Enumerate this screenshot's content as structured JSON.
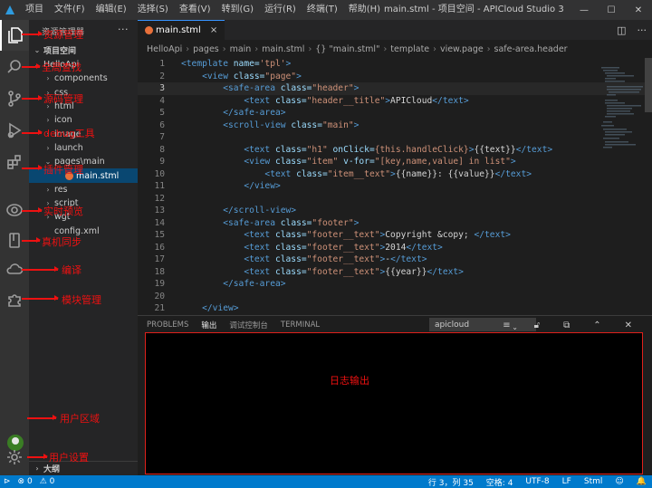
{
  "titlebar": {
    "menus": [
      "项目",
      "文件(F)",
      "编辑(E)",
      "选择(S)",
      "查看(V)",
      "转到(G)",
      "运行(R)",
      "终端(T)",
      "帮助(H)"
    ],
    "title": "main.stml - 项目空间 - APICloud Studio 3",
    "controls": [
      "—",
      "☐",
      "✕"
    ]
  },
  "activity_bar": [
    "files-icon",
    "search-icon",
    "source-control-icon",
    "debug-icon",
    "extensions-icon",
    "preview-icon",
    "sync-icon",
    "cloud-icon",
    "puzzle-icon",
    "avatar",
    "gear-icon"
  ],
  "sidebar": {
    "header": "资源管理器",
    "more": "···",
    "workspace": "项目空间",
    "tree": [
      {
        "label": "HelloApi",
        "twisty": "⌄",
        "level": 1
      },
      {
        "label": "components",
        "twisty": "›",
        "level": 2
      },
      {
        "label": "css",
        "twisty": "›",
        "level": 2
      },
      {
        "label": "html",
        "twisty": "›",
        "level": 2
      },
      {
        "label": "icon",
        "twisty": "›",
        "level": 2
      },
      {
        "label": "image",
        "twisty": "›",
        "level": 2
      },
      {
        "label": "launch",
        "twisty": "›",
        "level": 2
      },
      {
        "label": "pages\\main",
        "twisty": "⌄",
        "level": 2
      },
      {
        "label": "main.stml",
        "twisty": "",
        "level": 3,
        "selected": true
      },
      {
        "label": "res",
        "twisty": "›",
        "level": 2
      },
      {
        "label": "script",
        "twisty": "›",
        "level": 2
      },
      {
        "label": "wgt",
        "twisty": "›",
        "level": 2
      },
      {
        "label": "config.xml",
        "twisty": "",
        "level": 2
      }
    ],
    "outline": "大纲"
  },
  "editor": {
    "tab": "main.stml",
    "tab_close": "×",
    "breadcrumbs": [
      "HelloApi",
      "pages",
      "main",
      "main.stml",
      "{} \"main.stml\"",
      "template",
      "view.page",
      "safe-area.header"
    ],
    "lines": [
      [
        [
          "t",
          "<template "
        ],
        [
          "a",
          "name="
        ],
        [
          "s",
          "'tpl'"
        ],
        [
          "t",
          ">"
        ]
      ],
      [
        [
          "x",
          "    "
        ],
        [
          "t",
          "<view "
        ],
        [
          "a",
          "class="
        ],
        [
          "s",
          "\"page\""
        ],
        [
          "t",
          ">"
        ]
      ],
      [
        [
          "x",
          "        "
        ],
        [
          "t",
          "<safe-area "
        ],
        [
          "a",
          "class="
        ],
        [
          "s",
          "\"header\""
        ],
        [
          "t",
          ">"
        ]
      ],
      [
        [
          "x",
          "            "
        ],
        [
          "t",
          "<text "
        ],
        [
          "a",
          "class="
        ],
        [
          "s",
          "\"header__title\""
        ],
        [
          "t",
          ">"
        ],
        [
          "x",
          "APICloud"
        ],
        [
          "t",
          "</text>"
        ]
      ],
      [
        [
          "x",
          "        "
        ],
        [
          "t",
          "</safe-area>"
        ]
      ],
      [
        [
          "x",
          "        "
        ],
        [
          "t",
          "<scroll-view "
        ],
        [
          "a",
          "class="
        ],
        [
          "s",
          "\"main\""
        ],
        [
          "t",
          ">"
        ]
      ],
      [],
      [
        [
          "x",
          "            "
        ],
        [
          "t",
          "<text "
        ],
        [
          "a",
          "class="
        ],
        [
          "s",
          "\"h1\" "
        ],
        [
          "a",
          "onClick="
        ],
        [
          "s",
          "{this.handleClick}"
        ],
        [
          "t",
          ">"
        ],
        [
          "x",
          "{{text}}"
        ],
        [
          "t",
          "</text>"
        ]
      ],
      [
        [
          "x",
          "            "
        ],
        [
          "t",
          "<view "
        ],
        [
          "a",
          "class="
        ],
        [
          "s",
          "\"item\" "
        ],
        [
          "a",
          "v-for="
        ],
        [
          "s",
          "\"[key,name,value] in list\""
        ],
        [
          "t",
          ">"
        ]
      ],
      [
        [
          "x",
          "                "
        ],
        [
          "t",
          "<text "
        ],
        [
          "a",
          "class="
        ],
        [
          "s",
          "\"item__text\""
        ],
        [
          "t",
          ">"
        ],
        [
          "x",
          "{{name}}: {{value}}"
        ],
        [
          "t",
          "</text>"
        ]
      ],
      [
        [
          "x",
          "            "
        ],
        [
          "t",
          "</view>"
        ]
      ],
      [],
      [
        [
          "x",
          "        "
        ],
        [
          "t",
          "</scroll-view>"
        ]
      ],
      [
        [
          "x",
          "        "
        ],
        [
          "t",
          "<safe-area "
        ],
        [
          "a",
          "class="
        ],
        [
          "s",
          "\"footer\""
        ],
        [
          "t",
          ">"
        ]
      ],
      [
        [
          "x",
          "            "
        ],
        [
          "t",
          "<text "
        ],
        [
          "a",
          "class="
        ],
        [
          "s",
          "\"footer__text\""
        ],
        [
          "t",
          ">"
        ],
        [
          "x",
          "Copyright &copy; "
        ],
        [
          "t",
          "</text>"
        ]
      ],
      [
        [
          "x",
          "            "
        ],
        [
          "t",
          "<text "
        ],
        [
          "a",
          "class="
        ],
        [
          "s",
          "\"footer__text\""
        ],
        [
          "t",
          ">"
        ],
        [
          "x",
          "2014"
        ],
        [
          "t",
          "</text>"
        ]
      ],
      [
        [
          "x",
          "            "
        ],
        [
          "t",
          "<text "
        ],
        [
          "a",
          "class="
        ],
        [
          "s",
          "\"footer__text\""
        ],
        [
          "t",
          ">"
        ],
        [
          "x",
          "-"
        ],
        [
          "t",
          "</text>"
        ]
      ],
      [
        [
          "x",
          "            "
        ],
        [
          "t",
          "<text "
        ],
        [
          "a",
          "class="
        ],
        [
          "s",
          "\"footer__text\""
        ],
        [
          "t",
          ">"
        ],
        [
          "x",
          "{{year}}"
        ],
        [
          "t",
          "</text>"
        ]
      ],
      [
        [
          "x",
          "        "
        ],
        [
          "t",
          "</safe-area>"
        ]
      ],
      [],
      [
        [
          "x",
          "    "
        ],
        [
          "t",
          "</view>"
        ]
      ]
    ],
    "current_line": 3
  },
  "panel": {
    "tabs": [
      "PROBLEMS",
      "输出",
      "调试控制台",
      "TERMINAL"
    ],
    "active_tab": 1,
    "select_value": "apicloud",
    "log_label": "日志输出"
  },
  "statusbar": {
    "errors": "⊗ 0",
    "warnings": "⚠ 0",
    "position": "行 3，列 35",
    "indent": "空格: 4",
    "encoding": "UTF-8",
    "eol": "LF",
    "language": "Stml",
    "feedback": "☺",
    "bell": "🔔"
  },
  "annotations": [
    "资源管理",
    "全局查找",
    "源码管理",
    "debug工具",
    "插件管理",
    "实时预览",
    "真机同步",
    "编译",
    "模块管理",
    "用户区域",
    "用户设置"
  ],
  "colors": {
    "annotation": "#ee1111",
    "statusbar": "#007acc",
    "selected": "#094771"
  }
}
